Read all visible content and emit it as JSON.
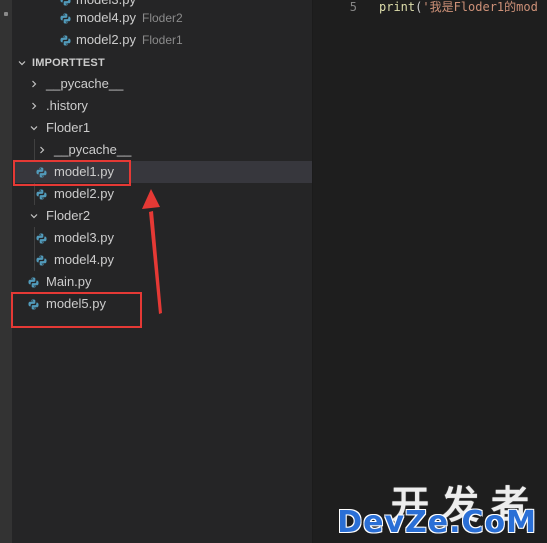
{
  "open_editors": [
    {
      "label": "model3.py",
      "desc": ""
    },
    {
      "label": "model4.py",
      "desc": "Floder2"
    },
    {
      "label": "model2.py",
      "desc": "Floder1"
    }
  ],
  "explorer": {
    "section_title": "IMPORTTEST",
    "items": [
      {
        "label": "__pycache__"
      },
      {
        "label": ".history"
      },
      {
        "label": "Floder1"
      },
      {
        "label": "__pycache__"
      },
      {
        "label": "model1.py"
      },
      {
        "label": "model2.py"
      },
      {
        "label": "Floder2"
      },
      {
        "label": "model3.py"
      },
      {
        "label": "model4.py"
      },
      {
        "label": "Main.py"
      },
      {
        "label": "model5.py"
      }
    ]
  },
  "editor": {
    "line_number": "5",
    "code_fn": "print",
    "code_paren": "(",
    "code_string": "'我是Floder1的mod"
  },
  "watermark": {
    "line1": "开发者",
    "line2": "DevZe.CoM"
  },
  "colors": {
    "python_icon": "#519aba",
    "annotation_red": "#e53935",
    "sidebar_bg": "#252526",
    "editor_bg": "#1e1e1e"
  },
  "icons": {
    "file": "python-file-icon",
    "folder_expanded": "chevron-down-icon",
    "folder_collapsed": "chevron-right-icon"
  }
}
